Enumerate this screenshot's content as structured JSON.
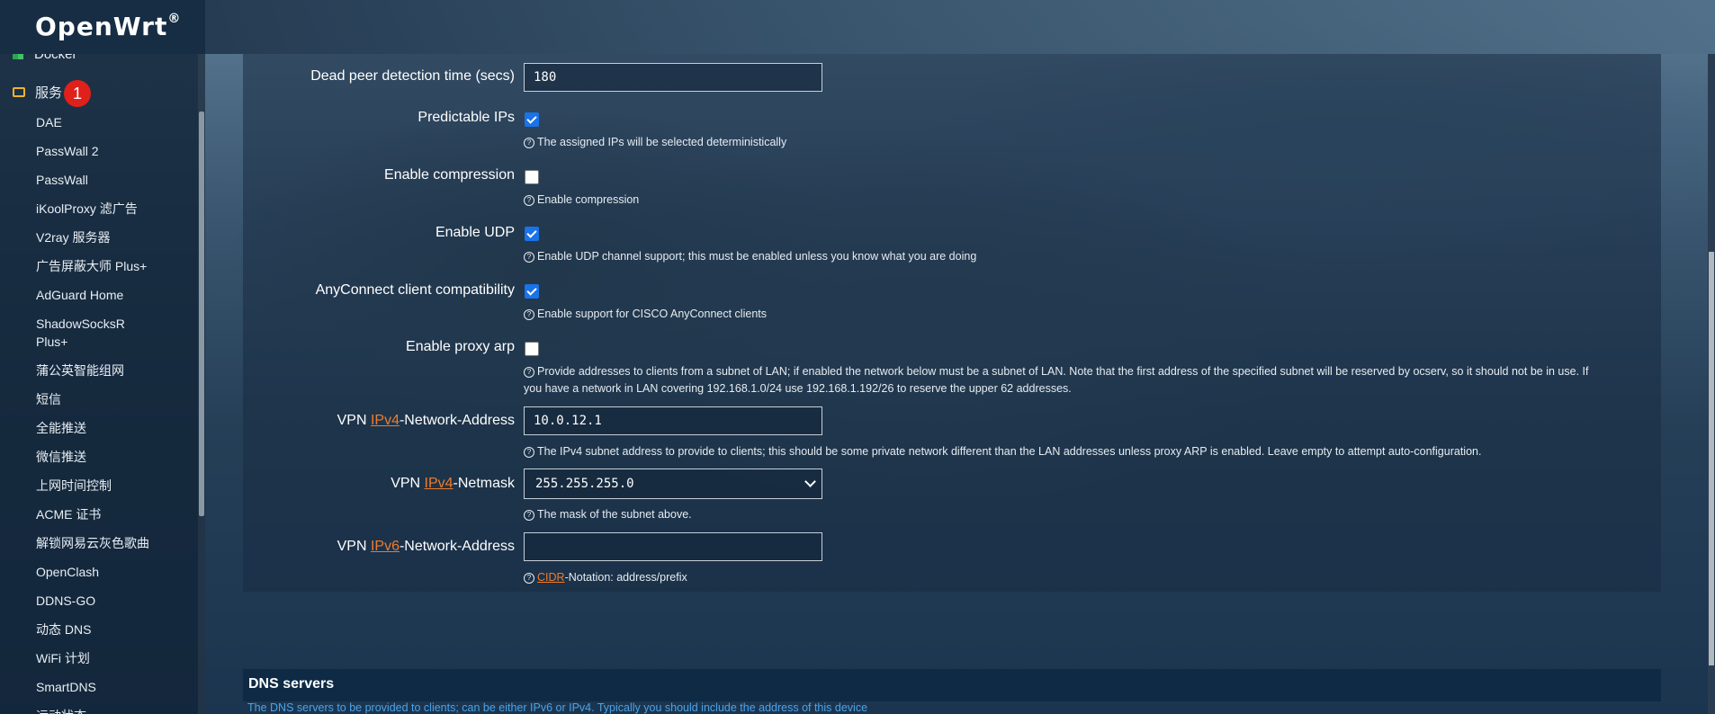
{
  "brand": {
    "name": "OpenWrt",
    "reg": "®"
  },
  "sidebar": {
    "top_items": [
      {
        "label": "Docker",
        "icon": "docker-icon"
      },
      {
        "label": "服务",
        "icon": "services-icon",
        "badge": "1"
      }
    ],
    "items": [
      {
        "label": "DAE"
      },
      {
        "label": "PassWall 2"
      },
      {
        "label": "PassWall"
      },
      {
        "label": "iKoolProxy 滤广告"
      },
      {
        "label": "V2ray 服务器"
      },
      {
        "label": "广告屏蔽大师 Plus+"
      },
      {
        "label": "AdGuard Home"
      },
      {
        "label": "ShadowSocksR"
      },
      {
        "label": "Plus+"
      },
      {
        "label": "蒲公英智能组网"
      },
      {
        "label": "短信"
      },
      {
        "label": "全能推送"
      },
      {
        "label": "微信推送"
      },
      {
        "label": "上网时间控制"
      },
      {
        "label": "ACME 证书"
      },
      {
        "label": "解锁网易云灰色歌曲"
      },
      {
        "label": "OpenClash"
      },
      {
        "label": "DDNS-GO"
      },
      {
        "label": "动态 DNS"
      },
      {
        "label": "WiFi 计划"
      },
      {
        "label": "SmartDNS"
      },
      {
        "label": "运动状态"
      }
    ]
  },
  "form": {
    "dpd": {
      "label": "Dead peer detection time (secs)",
      "value": "180"
    },
    "predictable_ips": {
      "label": "Predictable IPs",
      "checked": true,
      "desc": "The assigned IPs will be selected deterministically"
    },
    "compression": {
      "label": "Enable compression",
      "checked": false,
      "desc": "Enable compression"
    },
    "udp": {
      "label": "Enable UDP",
      "checked": true,
      "desc": "Enable UDP channel support; this must be enabled unless you know what you are doing"
    },
    "anyconnect": {
      "label": "AnyConnect client compatibility",
      "checked": true,
      "desc": "Enable support for CISCO AnyConnect clients"
    },
    "proxy_arp": {
      "label": "Enable proxy arp",
      "checked": false,
      "desc_line1": "Provide addresses to clients from a subnet of LAN; if enabled the network below must be a subnet of LAN. Note that the first address of the specified subnet will be reserved by ocserv, so it should not be in use. If",
      "desc_line2": "you have a network in LAN covering 192.168.1.0/24 use 192.168.1.192/26 to reserve the upper 62 addresses."
    },
    "ipv4_addr": {
      "label_pre": "VPN ",
      "label_abbr": "IPv4",
      "label_post": "-Network-Address",
      "value": "10.0.12.1",
      "desc": "The IPv4 subnet address to provide to clients; this should be some private network different than the LAN addresses unless proxy ARP is enabled. Leave empty to attempt auto-configuration."
    },
    "ipv4_mask": {
      "label_pre": "VPN ",
      "label_abbr": "IPv4",
      "label_post": "-Netmask",
      "value": "255.255.255.0",
      "desc": "The mask of the subnet above."
    },
    "ipv6_addr": {
      "label_pre": "VPN ",
      "label_abbr": "IPv6",
      "label_post": "-Network-Address",
      "value": "",
      "desc_abbr": "CIDR",
      "desc_post": "-Notation: address/prefix"
    }
  },
  "dns": {
    "title": "DNS servers",
    "desc": "The DNS servers to be provided to clients; can be either IPv6 or IPv4. Typically you should include the address of this device"
  },
  "colors": {
    "accent": "#f07b2c",
    "checkbox": "#1a73e8",
    "badge": "#e0201a",
    "dns_link": "#4aa3e8"
  }
}
